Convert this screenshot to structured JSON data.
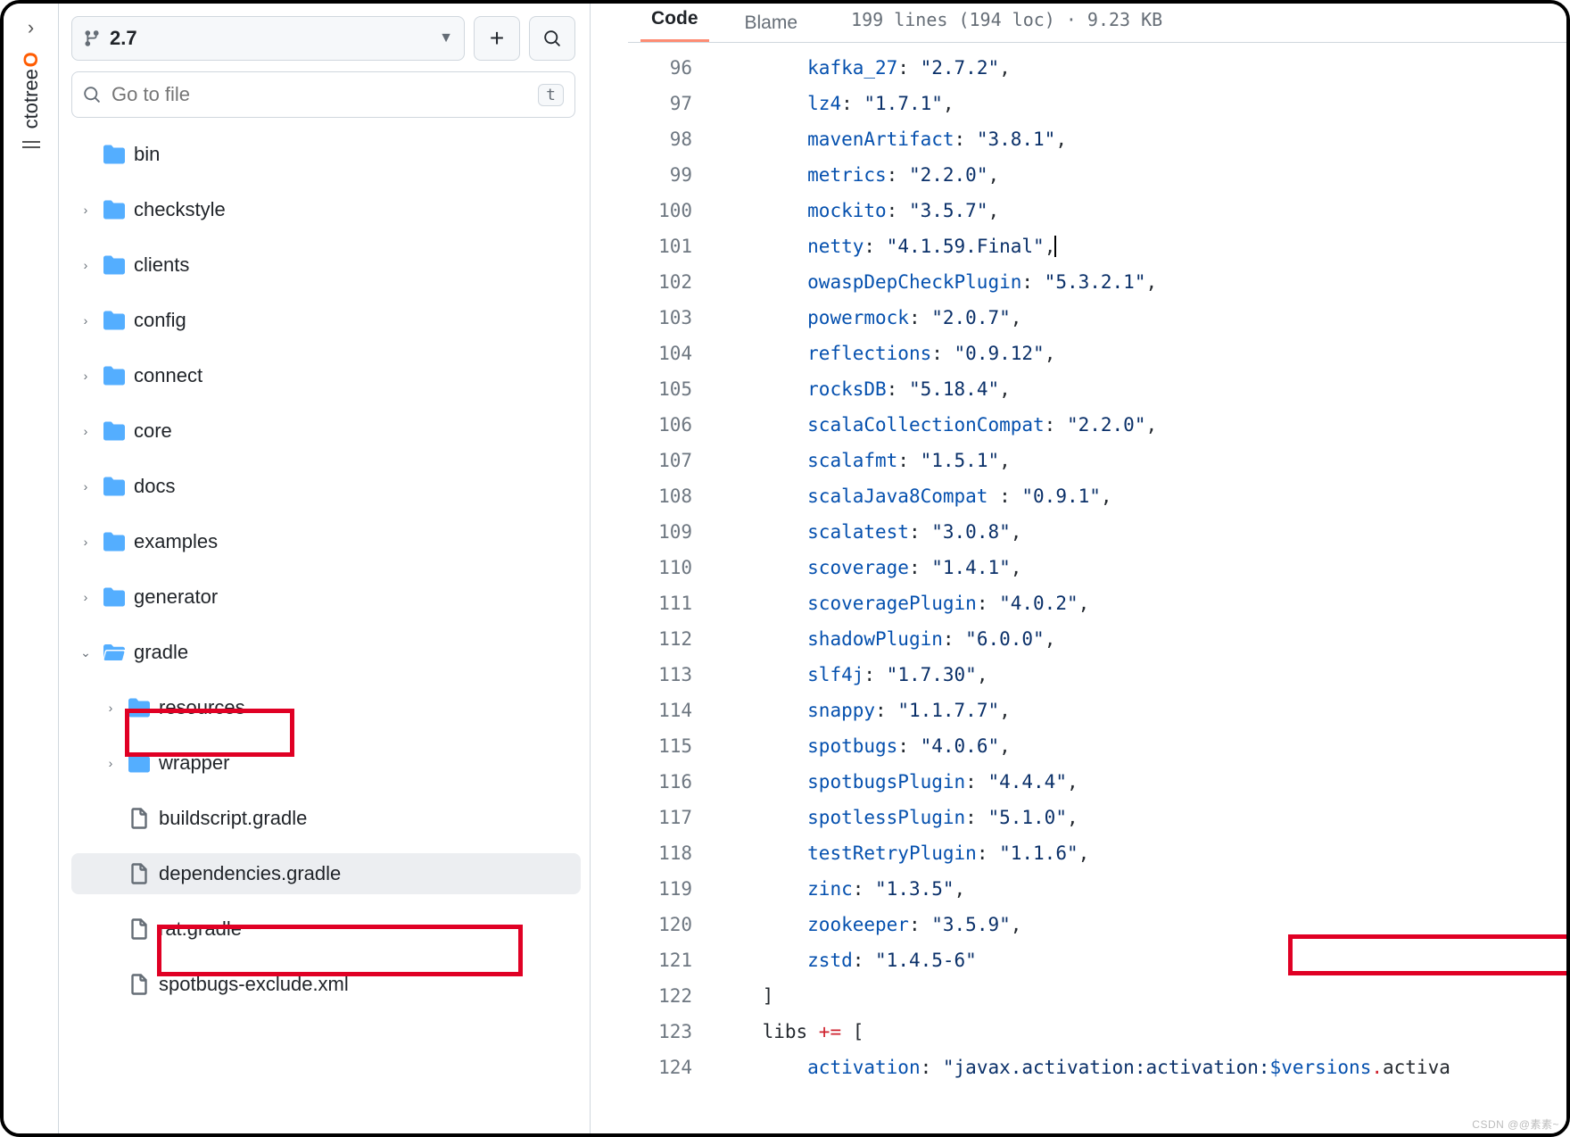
{
  "octotree": {
    "label_oct": "ctotree",
    "label_o": "O"
  },
  "branch": {
    "name": "2.7"
  },
  "goto": {
    "placeholder": "Go to file",
    "kbd": "t"
  },
  "tree": [
    {
      "type": "folder",
      "name": "bin",
      "level": 0,
      "chev": "",
      "open": false
    },
    {
      "type": "folder",
      "name": "checkstyle",
      "level": 0,
      "chev": ">",
      "open": false
    },
    {
      "type": "folder",
      "name": "clients",
      "level": 0,
      "chev": ">",
      "open": false
    },
    {
      "type": "folder",
      "name": "config",
      "level": 0,
      "chev": ">",
      "open": false
    },
    {
      "type": "folder",
      "name": "connect",
      "level": 0,
      "chev": ">",
      "open": false
    },
    {
      "type": "folder",
      "name": "core",
      "level": 0,
      "chev": ">",
      "open": false
    },
    {
      "type": "folder",
      "name": "docs",
      "level": 0,
      "chev": ">",
      "open": false
    },
    {
      "type": "folder",
      "name": "examples",
      "level": 0,
      "chev": ">",
      "open": false
    },
    {
      "type": "folder",
      "name": "generator",
      "level": 0,
      "chev": ">",
      "open": false
    },
    {
      "type": "folder",
      "name": "gradle",
      "level": 0,
      "chev": "v",
      "open": true
    },
    {
      "type": "folder",
      "name": "resources",
      "level": 1,
      "chev": ">",
      "open": false
    },
    {
      "type": "folder",
      "name": "wrapper",
      "level": 1,
      "chev": ">",
      "open": false
    },
    {
      "type": "file",
      "name": "buildscript.gradle",
      "level": 1,
      "chev": ""
    },
    {
      "type": "file",
      "name": "dependencies.gradle",
      "level": 1,
      "chev": "",
      "selected": true
    },
    {
      "type": "file",
      "name": "rat.gradle",
      "level": 1,
      "chev": ""
    },
    {
      "type": "file",
      "name": "spotbugs-exclude.xml",
      "level": 1,
      "chev": ""
    }
  ],
  "tabs": {
    "code": "Code",
    "blame": "Blame"
  },
  "file_info": "199 lines (194 loc) · 9.23 KB",
  "code": [
    {
      "n": 96,
      "indent": "        ",
      "key": "kafka_27",
      "sep": ": ",
      "val": "\"2.7.2\"",
      "trail": ","
    },
    {
      "n": 97,
      "indent": "        ",
      "key": "lz4",
      "sep": ": ",
      "val": "\"1.7.1\"",
      "trail": ","
    },
    {
      "n": 98,
      "indent": "        ",
      "key": "mavenArtifact",
      "sep": ": ",
      "val": "\"3.8.1\"",
      "trail": ","
    },
    {
      "n": 99,
      "indent": "        ",
      "key": "metrics",
      "sep": ": ",
      "val": "\"2.2.0\"",
      "trail": ","
    },
    {
      "n": 100,
      "indent": "        ",
      "key": "mockito",
      "sep": ": ",
      "val": "\"3.5.7\"",
      "trail": ","
    },
    {
      "n": 101,
      "indent": "        ",
      "key": "netty",
      "sep": ": ",
      "val": "\"4.1.59.Final\"",
      "trail": ",",
      "cursor": true
    },
    {
      "n": 102,
      "indent": "        ",
      "key": "owaspDepCheckPlugin",
      "sep": ": ",
      "val": "\"5.3.2.1\"",
      "trail": ","
    },
    {
      "n": 103,
      "indent": "        ",
      "key": "powermock",
      "sep": ": ",
      "val": "\"2.0.7\"",
      "trail": ","
    },
    {
      "n": 104,
      "indent": "        ",
      "key": "reflections",
      "sep": ": ",
      "val": "\"0.9.12\"",
      "trail": ","
    },
    {
      "n": 105,
      "indent": "        ",
      "key": "rocksDB",
      "sep": ": ",
      "val": "\"5.18.4\"",
      "trail": ","
    },
    {
      "n": 106,
      "indent": "        ",
      "key": "scalaCollectionCompat",
      "sep": ": ",
      "val": "\"2.2.0\"",
      "trail": ","
    },
    {
      "n": 107,
      "indent": "        ",
      "key": "scalafmt",
      "sep": ": ",
      "val": "\"1.5.1\"",
      "trail": ","
    },
    {
      "n": 108,
      "indent": "        ",
      "key": "scalaJava8Compat ",
      "sep": ": ",
      "val": "\"0.9.1\"",
      "trail": ","
    },
    {
      "n": 109,
      "indent": "        ",
      "key": "scalatest",
      "sep": ": ",
      "val": "\"3.0.8\"",
      "trail": ","
    },
    {
      "n": 110,
      "indent": "        ",
      "key": "scoverage",
      "sep": ": ",
      "val": "\"1.4.1\"",
      "trail": ","
    },
    {
      "n": 111,
      "indent": "        ",
      "key": "scoveragePlugin",
      "sep": ": ",
      "val": "\"4.0.2\"",
      "trail": ","
    },
    {
      "n": 112,
      "indent": "        ",
      "key": "shadowPlugin",
      "sep": ": ",
      "val": "\"6.0.0\"",
      "trail": ","
    },
    {
      "n": 113,
      "indent": "        ",
      "key": "slf4j",
      "sep": ": ",
      "val": "\"1.7.30\"",
      "trail": ","
    },
    {
      "n": 114,
      "indent": "        ",
      "key": "snappy",
      "sep": ": ",
      "val": "\"1.1.7.7\"",
      "trail": ","
    },
    {
      "n": 115,
      "indent": "        ",
      "key": "spotbugs",
      "sep": ": ",
      "val": "\"4.0.6\"",
      "trail": ","
    },
    {
      "n": 116,
      "indent": "        ",
      "key": "spotbugsPlugin",
      "sep": ": ",
      "val": "\"4.4.4\"",
      "trail": ","
    },
    {
      "n": 117,
      "indent": "        ",
      "key": "spotlessPlugin",
      "sep": ": ",
      "val": "\"5.1.0\"",
      "trail": ","
    },
    {
      "n": 118,
      "indent": "        ",
      "key": "testRetryPlugin",
      "sep": ": ",
      "val": "\"1.1.6\"",
      "trail": ","
    },
    {
      "n": 119,
      "indent": "        ",
      "key": "zinc",
      "sep": ": ",
      "val": "\"1.3.5\"",
      "trail": ","
    },
    {
      "n": 120,
      "indent": "        ",
      "key": "zookeeper",
      "sep": ": ",
      "val": "\"3.5.9\"",
      "trail": ","
    },
    {
      "n": 121,
      "indent": "        ",
      "key": "zstd",
      "sep": ": ",
      "val": "\"1.4.5-6\"",
      "trail": ""
    },
    {
      "n": 122,
      "raw": "    ]"
    },
    {
      "n": 123,
      "raw_parts": [
        {
          "t": "    ",
          "c": "p"
        },
        {
          "t": "libs ",
          "c": "p"
        },
        {
          "t": "+=",
          "c": "op"
        },
        {
          "t": " [",
          "c": "p"
        }
      ]
    },
    {
      "n": 124,
      "raw_parts": [
        {
          "t": "        ",
          "c": "p"
        },
        {
          "t": "activation",
          "c": "k"
        },
        {
          "t": ": ",
          "c": "p"
        },
        {
          "t": "\"javax.activation:activation:",
          "c": "s"
        },
        {
          "t": "$versions",
          "c": "k"
        },
        {
          "t": ".",
          "c": "op"
        },
        {
          "t": "activa",
          "c": "p"
        }
      ]
    }
  ],
  "watermark": "CSDN @@素素~"
}
